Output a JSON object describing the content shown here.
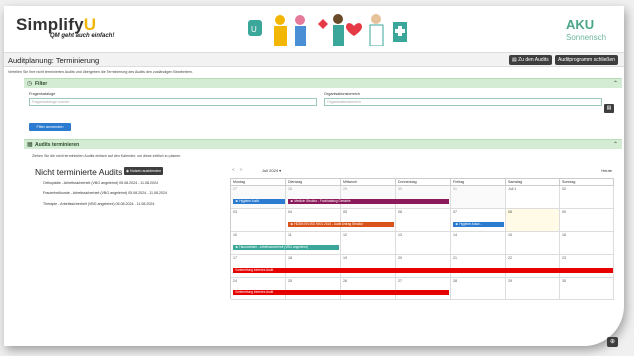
{
  "brand": {
    "logo_main": "Simplify",
    "logo_u": "U",
    "slogan": "QM geht auch einfach!",
    "partner_name": "AKU",
    "partner_sub": "Sonnensch"
  },
  "page": {
    "title": "Auditplanung: Terminierung",
    "btn_audits": "Zu den Audits",
    "btn_program": "Auditprogramm schließen",
    "hint": "Verteilen Sie Ihre nicht terminierten Audits und übergeben die Terminierung des Audits den zuständigen Bearbeitern."
  },
  "filter": {
    "header": "Filter",
    "fragen_label": "Fragenkataloge",
    "fragen_placeholder": "Fragenkataloge suchen",
    "org_label": "Organisationsbereich",
    "org_placeholder": "Organisationsbereich",
    "apply_label": "Filter anwenden"
  },
  "schedule": {
    "header": "Audits terminieren",
    "hint": "Ziehen Sie die nicht terminierten Audits einfach auf den Kalender, um diese zeitlich zu planen.",
    "untermined_title": "Nicht terminierte Audits",
    "hide_button": "Nutzen ausblenden",
    "items": [
      "Orthopädie - Arbeitssicherheit (VBG angelehnt) 05.08.2024 - 11.08.2024",
      "Frauenheilkunde - Arbeitssicherheit (VBG angelehnt) 05.08.2024 - 11.08.2024",
      "Therapie - Arbeitssicherheit (VBG angelehnt) 05.08.2024 - 11.08.2024"
    ]
  },
  "calendar": {
    "nav_prev": "<",
    "nav_next": ">",
    "month": "Juli 2024",
    "today": "Heute",
    "daynames": [
      "Montag",
      "Dienstag",
      "Mittwoch",
      "Donnerstag",
      "Freitag",
      "Samstag",
      "Sonntag"
    ],
    "weeks": [
      [
        "27",
        "28",
        "29",
        "30",
        "31",
        "Juli 1",
        "02"
      ],
      [
        "03",
        "04",
        "05",
        "06",
        "07",
        "08",
        "09"
      ],
      [
        "10",
        "11",
        "12",
        "13",
        "14",
        "15",
        "16"
      ],
      [
        "17",
        "18",
        "19",
        "20",
        "21",
        "22",
        "23"
      ],
      [
        "24",
        "25",
        "26",
        "27",
        "28",
        "29",
        "30"
      ]
    ],
    "events": {
      "e1": "Hygiene Audit",
      "e2": "Medizin Struktur - Fachkatalog Geriatrie",
      "e3": "HDDN EN ISO 9001 2015 - Audit Antrag Struktur",
      "e4": "Hygiene Ausw...",
      "e5": "Hausmeister - Arbeitssicherheit (VBG angelehnt)",
      "e6": "Vorbereitung internes Audit",
      "e7": "Vorbereitung internes Audit"
    }
  },
  "colors": {
    "accent_blue": "#2b7bd0",
    "section_green": "#d4ecd4",
    "event_red": "#e60000",
    "event_purple": "#8b1a5a",
    "event_orange": "#d9541a",
    "event_teal": "#3aa79a"
  }
}
